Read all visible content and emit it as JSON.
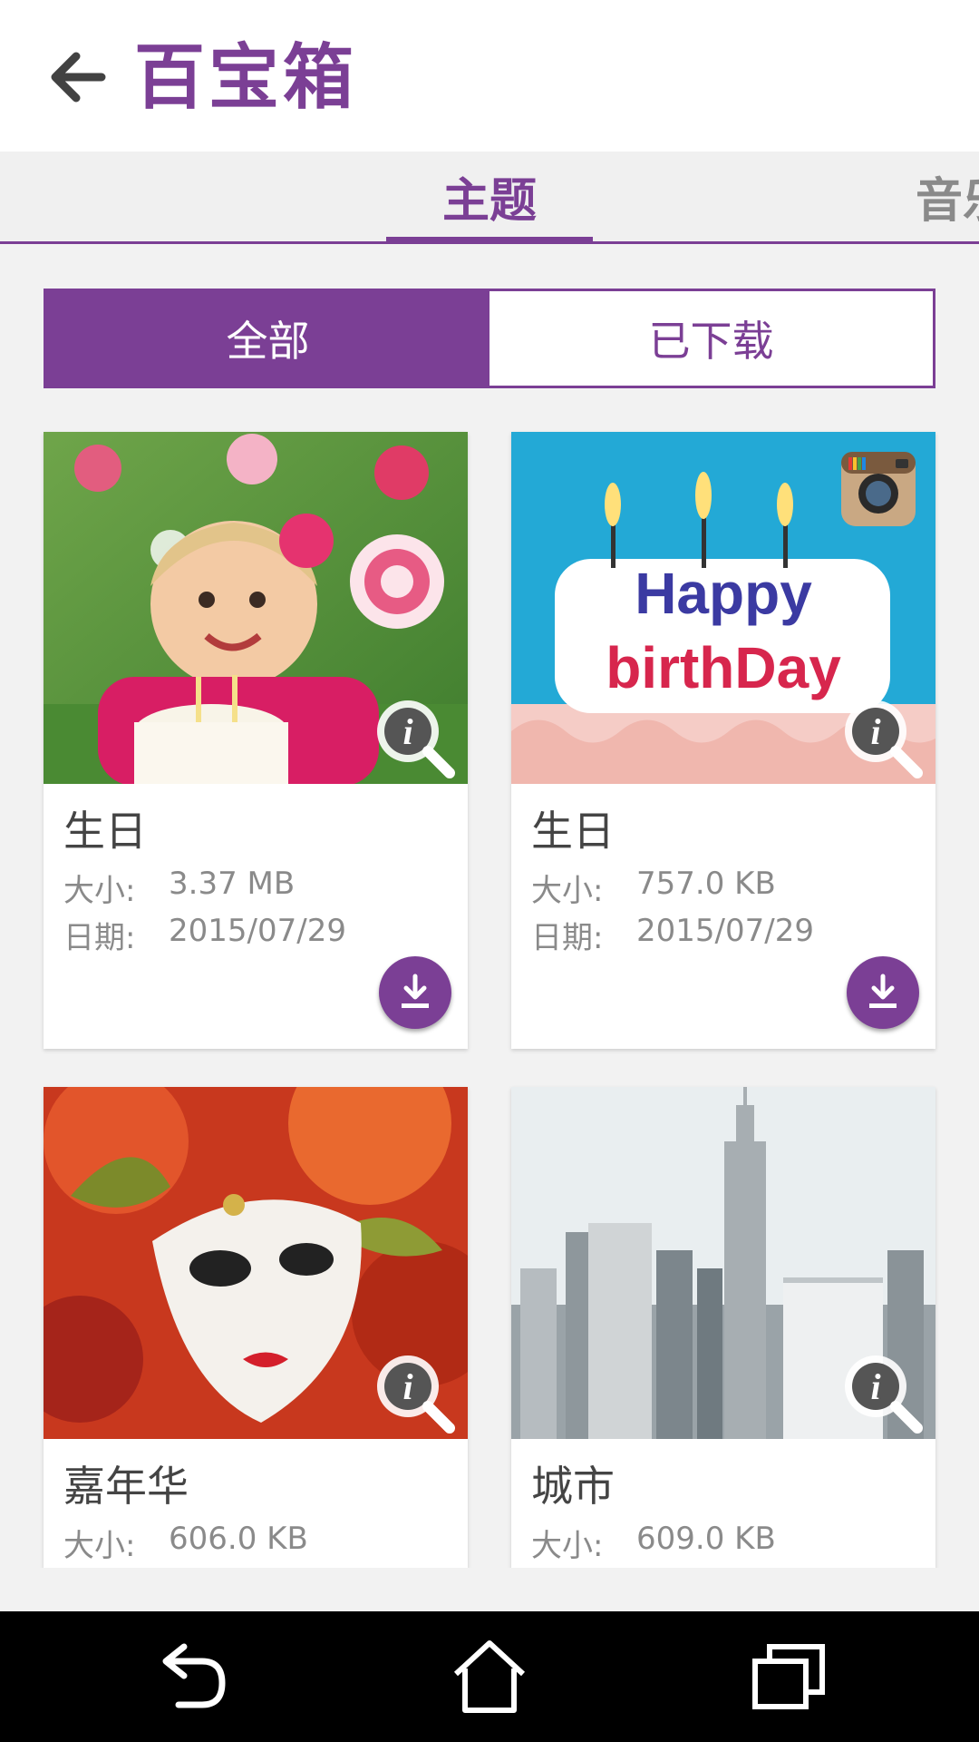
{
  "header": {
    "title": "百宝箱"
  },
  "tabs": [
    {
      "label": "主题",
      "selected": true
    },
    {
      "label": "音乐",
      "selected": false
    }
  ],
  "filter": {
    "all_label": "全部",
    "downloaded_label": "已下载",
    "selected": "全部"
  },
  "labels": {
    "size": "大小:",
    "date": "日期:"
  },
  "cards": [
    {
      "name": "生日",
      "size": "3.37 MB",
      "date": "2015/07/29",
      "thumbnail": "girl-birthday-cake-photo",
      "instagram_badge": false
    },
    {
      "name": "生日",
      "size": "757.0 KB",
      "date": "2015/07/29",
      "thumbnail": "happy-birthday-candles-photo",
      "instagram_badge": true
    },
    {
      "name": "嘉年华",
      "size": "606.0 KB",
      "date": "",
      "thumbnail": "carnival-mask-photo",
      "instagram_badge": false
    },
    {
      "name": "城市",
      "size": "609.0 KB",
      "date": "",
      "thumbnail": "city-skyline-photo",
      "instagram_badge": false
    }
  ],
  "colors": {
    "accent": "#7b3f95",
    "tab_bg": "#f0f0f0",
    "page_bg": "#f2f2f2",
    "text_muted": "#8a8a8a"
  },
  "navbar": {
    "buttons": [
      "back-icon",
      "home-icon",
      "recents-icon"
    ]
  }
}
